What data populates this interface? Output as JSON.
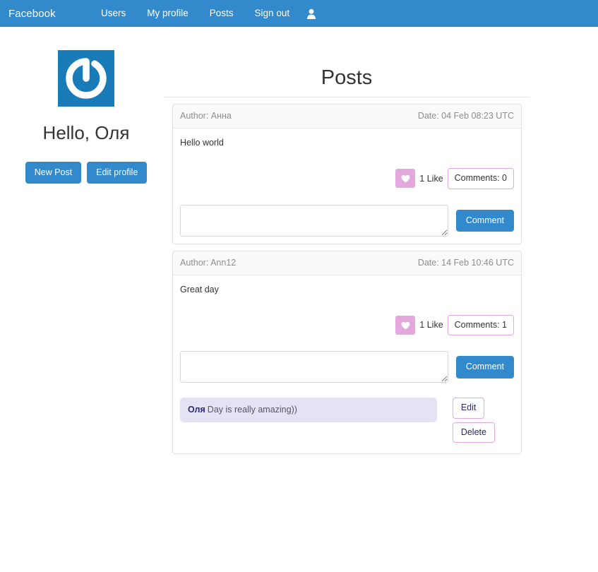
{
  "navbar": {
    "brand": "Facebook",
    "links": [
      {
        "label": "Users",
        "name": "nav-link-users"
      },
      {
        "label": "My profile",
        "name": "nav-link-my-profile"
      },
      {
        "label": "Posts",
        "name": "nav-link-posts"
      },
      {
        "label": "Sign out",
        "name": "nav-link-sign-out"
      }
    ],
    "user_icon": "user-icon",
    "background_color": "#3289cc",
    "text_color": "#ffffff"
  },
  "profile": {
    "avatar_icon": "gravatar-logo-icon",
    "avatar_background": "#1a7bb9",
    "greeting": "Hello, Оля",
    "buttons": {
      "new_post": "New Post",
      "edit_profile": "Edit profile"
    }
  },
  "main": {
    "title": "Posts"
  },
  "posts": [
    {
      "author_label": "Author: Анна",
      "date_label": "Date: 04 Feb 08:23 UTC",
      "text": "Hello world",
      "like_icon": "heart-icon",
      "like_label": "1 Like",
      "comments_label": "Comments: 0",
      "comment_input_value": "",
      "comment_input_placeholder": "",
      "comment_button": "Comment",
      "comments": []
    },
    {
      "author_label": "Author: Ann12",
      "date_label": "Date: 14 Feb 10:46 UTC",
      "text": "Great day",
      "like_icon": "heart-icon",
      "like_label": "1 Like",
      "comments_label": "Comments: 1",
      "comment_input_value": "",
      "comment_input_placeholder": "",
      "comment_button": "Comment",
      "comments": [
        {
          "author": "Оля",
          "text": "Day is really amazing))",
          "edit_label": "Edit",
          "delete_label": "Delete"
        }
      ]
    }
  ],
  "colors": {
    "brand_blue": "#3289cc",
    "like_pink": "#e3a9de",
    "comment_bubble": "#e4e3f4",
    "comment_author": "#282888"
  }
}
